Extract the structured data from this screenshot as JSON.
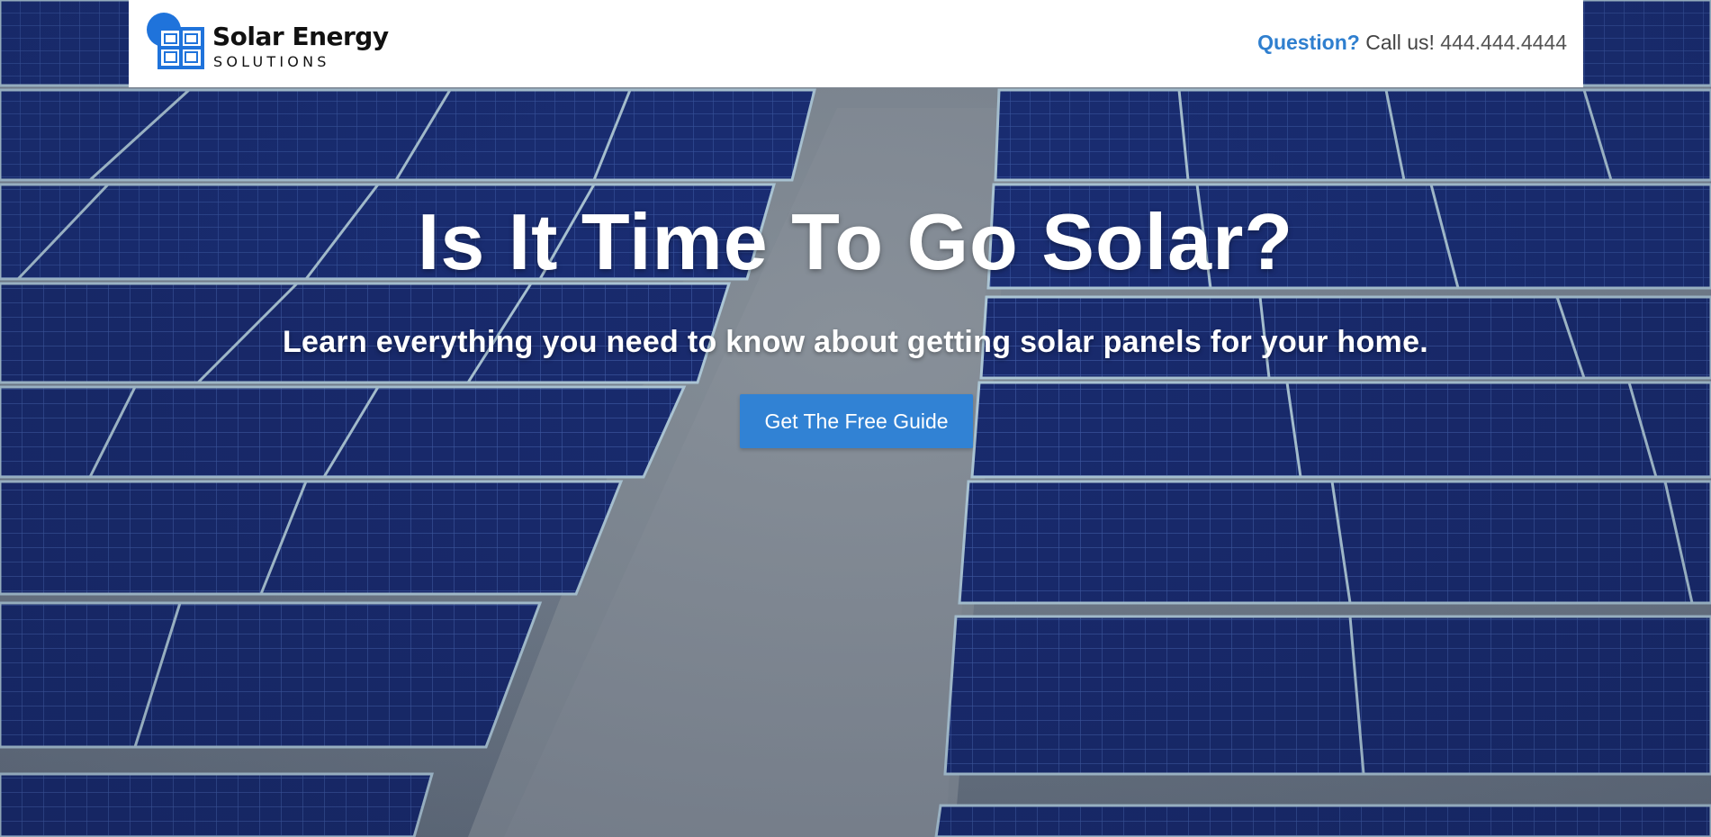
{
  "header": {
    "logo": {
      "title": "Solar Energy",
      "subtitle": "SOLUTIONS",
      "icon": "solar-panel-logo-icon",
      "colors": {
        "brand_blue": "#1f73db",
        "text": "#111111"
      }
    },
    "contact": {
      "question_label": "Question?",
      "call_text": "Call us!",
      "phone": "444.444.4444",
      "accent_color": "#2f7fcf"
    }
  },
  "hero": {
    "background": "solar-panel-field-image",
    "headline": "Is It Time To Go Solar?",
    "subheadline": "Learn everything you need to know about getting solar panels for your home.",
    "cta_label": "Get The Free Guide",
    "cta_color": "#3182d4"
  }
}
